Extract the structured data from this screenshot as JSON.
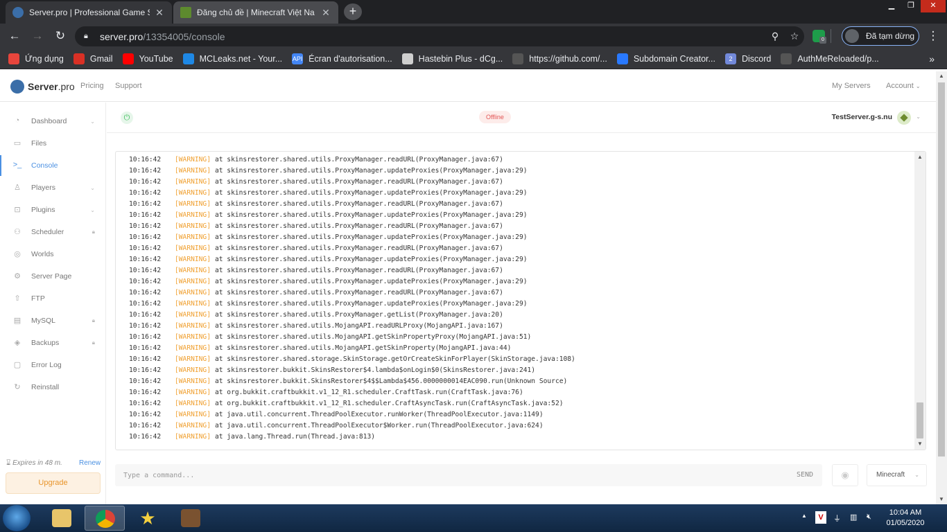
{
  "browser": {
    "tabs": [
      {
        "title": "Server.pro | Professional Game S",
        "active": true
      },
      {
        "title": "Đăng chủ đề | Minecraft Việt Na",
        "active": false
      }
    ],
    "new_tab_label": "+",
    "close_label": "✕",
    "url_domain": "server.pro",
    "url_path": "/13354005/console",
    "extension_badge": "0",
    "profile_label": "Đã tạm dừng",
    "bookmarks": [
      {
        "label": "Ứng dụng",
        "color": "#e8453c"
      },
      {
        "label": "Gmail",
        "color": "#d93025"
      },
      {
        "label": "YouTube",
        "color": "#ff0000"
      },
      {
        "label": "MCLeaks.net - Your...",
        "color": "#1e88e5"
      },
      {
        "label": "Écran d'autorisation...",
        "color": "#4285f4",
        "icon_text": "API"
      },
      {
        "label": "Hastebin Plus - dCg...",
        "color": "#cfcfcf"
      },
      {
        "label": "https://github.com/...",
        "color": "#555555"
      },
      {
        "label": "Subdomain Creator...",
        "color": "#2979ff"
      },
      {
        "label": "Discord",
        "color": "#7289da",
        "icon_text": "2"
      },
      {
        "label": "AuthMeReloaded/p...",
        "color": "#555555"
      }
    ]
  },
  "site": {
    "logo_text": "Server",
    "logo_suffix": ".pro",
    "nav": {
      "pricing": "Pricing",
      "support": "Support"
    },
    "right_nav": {
      "my_servers": "My Servers",
      "account": "Account"
    }
  },
  "sidebar": {
    "items": [
      {
        "label": "Dashboard",
        "icon": "dashboard-icon",
        "glyph": "◔",
        "caret": true
      },
      {
        "label": "Files",
        "icon": "files-icon",
        "glyph": "▭"
      },
      {
        "label": "Console",
        "icon": "console-icon",
        "glyph": ">_",
        "active": true
      },
      {
        "label": "Players",
        "icon": "players-icon",
        "glyph": "♙",
        "caret": true
      },
      {
        "label": "Plugins",
        "icon": "plugins-icon",
        "glyph": "⊡",
        "caret": true
      },
      {
        "label": "Scheduler",
        "icon": "scheduler-icon",
        "glyph": "⚇",
        "lock": true
      },
      {
        "label": "Worlds",
        "icon": "worlds-icon",
        "glyph": "◎"
      },
      {
        "label": "Server Page",
        "icon": "server-page-icon",
        "glyph": "⚙"
      },
      {
        "label": "FTP",
        "icon": "ftp-icon",
        "glyph": "⇧"
      },
      {
        "label": "MySQL",
        "icon": "mysql-icon",
        "glyph": "▤",
        "lock": true
      },
      {
        "label": "Backups",
        "icon": "backups-icon",
        "glyph": "◈",
        "lock": true
      },
      {
        "label": "Error Log",
        "icon": "error-log-icon",
        "glyph": "▢"
      },
      {
        "label": "Reinstall",
        "icon": "reinstall-icon",
        "glyph": "↻"
      }
    ],
    "expires": "Expires in 48 m.",
    "renew": "Renew",
    "upgrade": "Upgrade"
  },
  "status": {
    "state": "Offline",
    "server_name": "TestServer.g-s.nu"
  },
  "console": {
    "lines": [
      {
        "time": "10:16:42",
        "level": "[WARNING]",
        "text": "at skinsrestorer.shared.utils.ProxyManager.readURL(ProxyManager.java:67)"
      },
      {
        "time": "10:16:42",
        "level": "[WARNING]",
        "text": "at skinsrestorer.shared.utils.ProxyManager.updateProxies(ProxyManager.java:29)"
      },
      {
        "time": "10:16:42",
        "level": "[WARNING]",
        "text": "at skinsrestorer.shared.utils.ProxyManager.readURL(ProxyManager.java:67)"
      },
      {
        "time": "10:16:42",
        "level": "[WARNING]",
        "text": "at skinsrestorer.shared.utils.ProxyManager.updateProxies(ProxyManager.java:29)"
      },
      {
        "time": "10:16:42",
        "level": "[WARNING]",
        "text": "at skinsrestorer.shared.utils.ProxyManager.readURL(ProxyManager.java:67)"
      },
      {
        "time": "10:16:42",
        "level": "[WARNING]",
        "text": "at skinsrestorer.shared.utils.ProxyManager.updateProxies(ProxyManager.java:29)"
      },
      {
        "time": "10:16:42",
        "level": "[WARNING]",
        "text": "at skinsrestorer.shared.utils.ProxyManager.readURL(ProxyManager.java:67)"
      },
      {
        "time": "10:16:42",
        "level": "[WARNING]",
        "text": "at skinsrestorer.shared.utils.ProxyManager.updateProxies(ProxyManager.java:29)"
      },
      {
        "time": "10:16:42",
        "level": "[WARNING]",
        "text": "at skinsrestorer.shared.utils.ProxyManager.readURL(ProxyManager.java:67)"
      },
      {
        "time": "10:16:42",
        "level": "[WARNING]",
        "text": "at skinsrestorer.shared.utils.ProxyManager.updateProxies(ProxyManager.java:29)"
      },
      {
        "time": "10:16:42",
        "level": "[WARNING]",
        "text": "at skinsrestorer.shared.utils.ProxyManager.readURL(ProxyManager.java:67)"
      },
      {
        "time": "10:16:42",
        "level": "[WARNING]",
        "text": "at skinsrestorer.shared.utils.ProxyManager.updateProxies(ProxyManager.java:29)"
      },
      {
        "time": "10:16:42",
        "level": "[WARNING]",
        "text": "at skinsrestorer.shared.utils.ProxyManager.readURL(ProxyManager.java:67)"
      },
      {
        "time": "10:16:42",
        "level": "[WARNING]",
        "text": "at skinsrestorer.shared.utils.ProxyManager.updateProxies(ProxyManager.java:29)"
      },
      {
        "time": "10:16:42",
        "level": "[WARNING]",
        "text": "at skinsrestorer.shared.utils.ProxyManager.getList(ProxyManager.java:20)"
      },
      {
        "time": "10:16:42",
        "level": "[WARNING]",
        "text": "at skinsrestorer.shared.utils.MojangAPI.readURLProxy(MojangAPI.java:167)"
      },
      {
        "time": "10:16:42",
        "level": "[WARNING]",
        "text": "at skinsrestorer.shared.utils.MojangAPI.getSkinPropertyProxy(MojangAPI.java:51)"
      },
      {
        "time": "10:16:42",
        "level": "[WARNING]",
        "text": "at skinsrestorer.shared.utils.MojangAPI.getSkinProperty(MojangAPI.java:44)"
      },
      {
        "time": "10:16:42",
        "level": "[WARNING]",
        "text": "at skinsrestorer.shared.storage.SkinStorage.getOrCreateSkinForPlayer(SkinStorage.java:108)"
      },
      {
        "time": "10:16:42",
        "level": "[WARNING]",
        "text": "at skinsrestorer.bukkit.SkinsRestorer$4.lambda$onLogin$0(SkinsRestorer.java:241)"
      },
      {
        "time": "10:16:42",
        "level": "[WARNING]",
        "text": "at skinsrestorer.bukkit.SkinsRestorer$4$$Lambda$456.0000000014EAC090.run(Unknown Source)"
      },
      {
        "time": "10:16:42",
        "level": "[WARNING]",
        "text": "at org.bukkit.craftbukkit.v1_12_R1.scheduler.CraftTask.run(CraftTask.java:76)"
      },
      {
        "time": "10:16:42",
        "level": "[WARNING]",
        "text": "at org.bukkit.craftbukkit.v1_12_R1.scheduler.CraftAsyncTask.run(CraftAsyncTask.java:52)"
      },
      {
        "time": "10:16:42",
        "level": "[WARNING]",
        "text": "at java.util.concurrent.ThreadPoolExecutor.runWorker(ThreadPoolExecutor.java:1149)"
      },
      {
        "time": "10:16:42",
        "level": "[WARNING]",
        "text": "at java.util.concurrent.ThreadPoolExecutor$Worker.run(ThreadPoolExecutor.java:624)"
      },
      {
        "time": "10:16:42",
        "level": "[WARNING]",
        "text": "at java.lang.Thread.run(Thread.java:813)"
      }
    ],
    "placeholder": "Type a command...",
    "send": "SEND",
    "type_select": "Minecraft"
  },
  "taskbar": {
    "time": "10:04 AM",
    "date": "01/05/2020"
  },
  "colors": {
    "accent": "#4a90e2",
    "warning": "#f0a030",
    "offline": "#e25555",
    "power": "#3fbf5c",
    "upgrade": "#e8942a"
  }
}
